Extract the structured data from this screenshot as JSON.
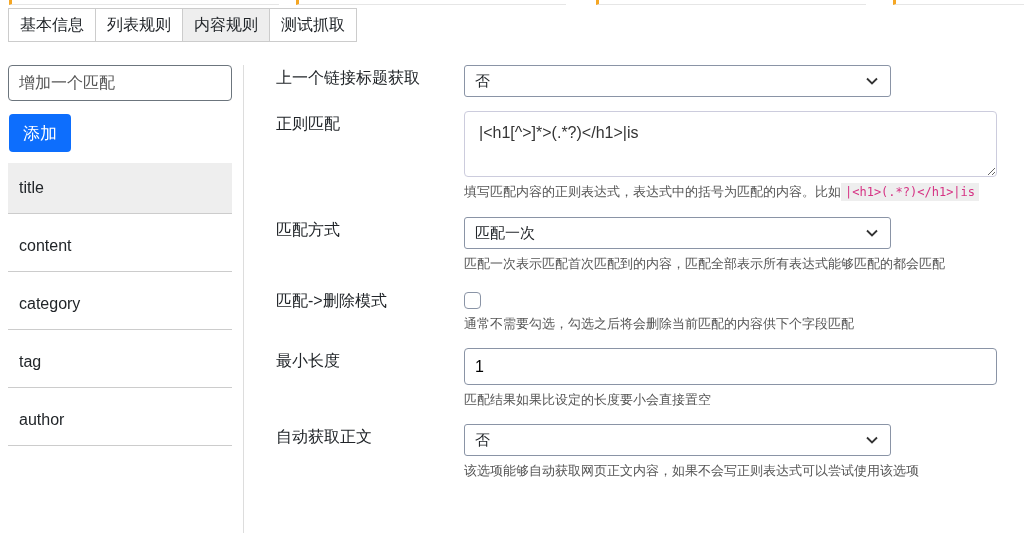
{
  "top_cards": [
    {
      "kind": "card"
    },
    {
      "kind": "card"
    },
    {
      "kind": "card"
    },
    {
      "kind": "card"
    }
  ],
  "tabs": [
    {
      "label": "基本信息",
      "selected": false
    },
    {
      "label": "列表规则",
      "selected": false
    },
    {
      "label": "内容规则",
      "selected": true
    },
    {
      "label": "测试抓取",
      "selected": false
    }
  ],
  "sidebar": {
    "add_field": {
      "placeholder": "增加一个匹配"
    },
    "add_button": "添加",
    "items": [
      {
        "label": "title",
        "selected": true
      },
      {
        "label": "content",
        "selected": false
      },
      {
        "label": "category",
        "selected": false
      },
      {
        "label": "tag",
        "selected": false
      },
      {
        "label": "author",
        "selected": false
      }
    ]
  },
  "form": [
    {
      "kind": "select",
      "label": "上一个链接标题获取",
      "value": "否"
    },
    {
      "kind": "textarea",
      "label": "正则匹配",
      "value": "|<h1[^>]*>(.*?)</h1>|is",
      "help": "填写匹配内容的正则表达式，表达式中的括号为匹配的内容。比如",
      "help_code": "|<h1>(.*?)</h1>|is"
    },
    {
      "kind": "select",
      "label": "匹配方式",
      "value": "匹配一次",
      "help": "匹配一次表示匹配首次匹配到的内容，匹配全部表示所有表达式能够匹配的都会匹配"
    },
    {
      "kind": "checkbox",
      "label": "匹配->删除模式",
      "checked": false,
      "help": "通常不需要勾选，勾选之后将会删除当前匹配的内容供下个字段匹配"
    },
    {
      "kind": "input",
      "label": "最小长度",
      "value": "1",
      "help": "匹配结果如果比设定的长度要小会直接置空"
    },
    {
      "kind": "select",
      "label": "自动获取正文",
      "value": "否",
      "help": "该选项能够自动获取网页正文内容，如果不会写正则表达式可以尝试使用该选项"
    }
  ]
}
